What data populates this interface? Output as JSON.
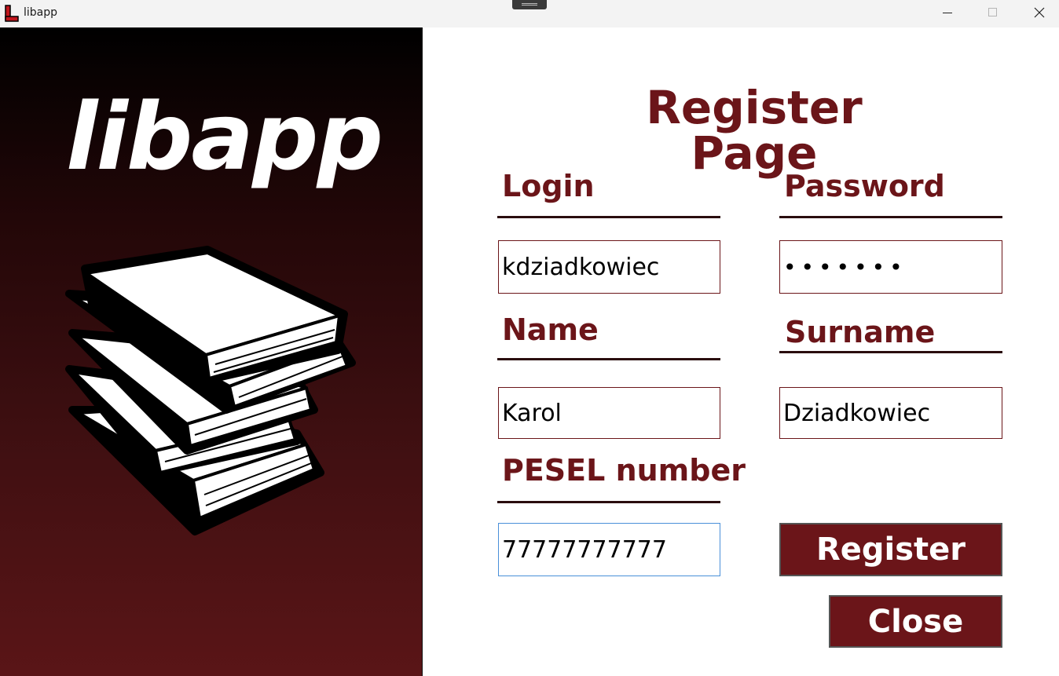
{
  "window": {
    "title": "libapp",
    "controls": [
      "minimize-icon",
      "maximize-icon",
      "close-icon"
    ]
  },
  "branding": {
    "logo_text": "libapp",
    "illustration": "books-stack-icon"
  },
  "form": {
    "title": "Register Page",
    "fields": {
      "login": {
        "label": "Login",
        "value": "kdziadkowiec"
      },
      "password": {
        "label": "Password",
        "value": "•••••••"
      },
      "name": {
        "label": "Name",
        "value": "Karol"
      },
      "surname": {
        "label": "Surname",
        "value": "Dziadkowiec"
      },
      "pesel": {
        "label": "PESEL number",
        "value": "77777777777"
      }
    },
    "buttons": {
      "register": "Register",
      "close": "Close"
    }
  },
  "colors": {
    "accent": "#6b1519",
    "underline": "#2a0d0e",
    "focus_border": "#4a90d9",
    "panel_gradient_top": "#000000",
    "panel_gradient_bottom": "#5a1517"
  }
}
